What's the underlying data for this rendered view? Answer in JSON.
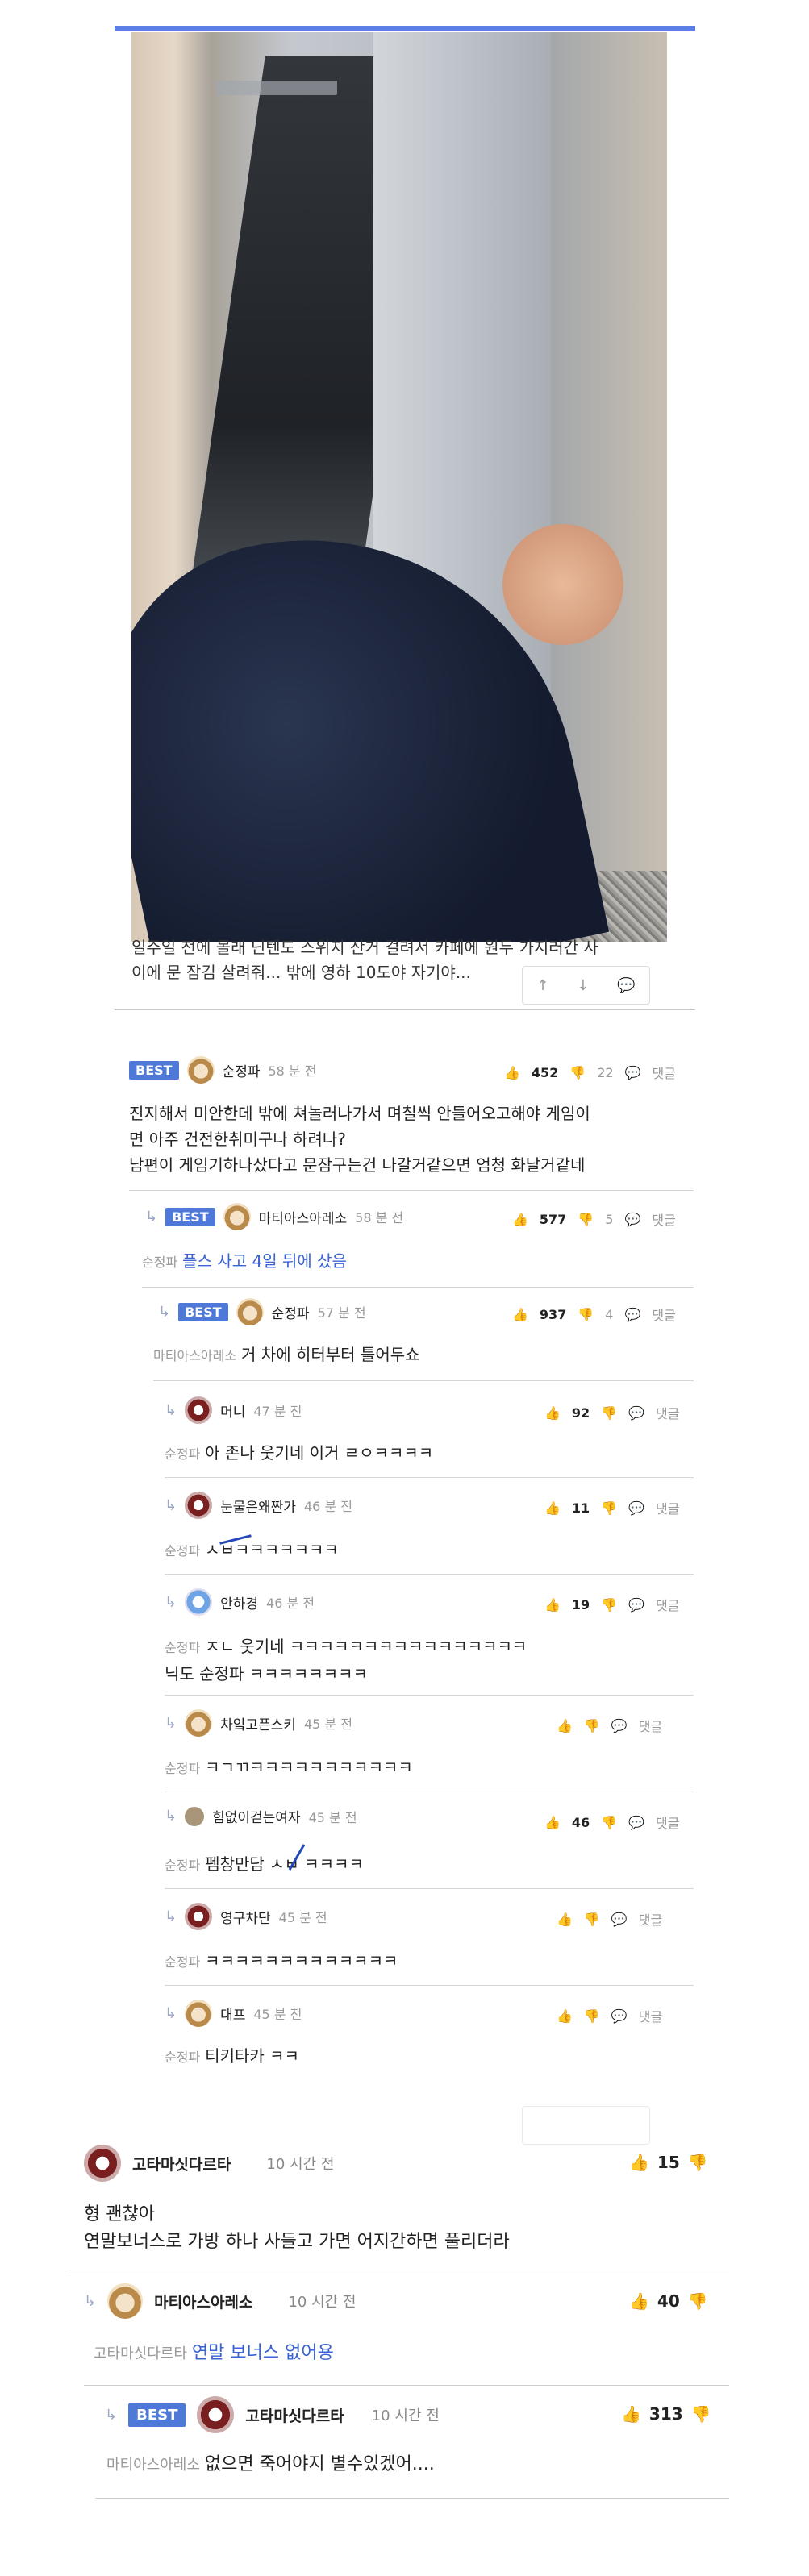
{
  "post": {
    "caption_line1": "일주일 전에 몰래 닌텐도 스위치 산거 걸려서  카페에 원두 가지러간 사",
    "caption_line2": "이에 문 잠김 살려줘... 밖에 영하 10도야 자기야...",
    "action_icons": [
      "↑",
      "↓",
      "💬"
    ]
  },
  "comments": [
    {
      "id": "c1",
      "best": "BEST",
      "name": "순정파",
      "time": "58 분 전",
      "up": "452",
      "down": "22",
      "reply": "댓글",
      "text": [
        "진지해서 미안한데 밖에 쳐놀러나가서 며칠씩 안들어오고해야 게임이",
        "면 아주 건전한취미구나 하려나?",
        "남편이 게임기하나샀다고 문잠구는건 나갈거같으면 엄청 화날거같네"
      ]
    },
    {
      "id": "c2",
      "best": "BEST",
      "name": "마티아스아레소",
      "time": "58 분 전",
      "up": "577",
      "down": "5",
      "reply": "댓글",
      "to": "순정파",
      "text": [
        "플스 사고 4일 뒤에 샀음"
      ]
    },
    {
      "id": "c3",
      "best": "BEST",
      "name": "순정파",
      "time": "57 분 전",
      "up": "937",
      "down": "4",
      "reply": "댓글",
      "to": "마티아스아레소",
      "text": [
        "거 차에 히터부터 틀어두쇼"
      ]
    },
    {
      "id": "c4",
      "name": "머니",
      "time": "47 분 전",
      "up": "92",
      "reply": "댓글",
      "to": "순정파",
      "text": [
        "아 존나 웃기네 이거 ㄹㅇㅋㅋㅋㅋ"
      ]
    },
    {
      "id": "c5",
      "name": "눈물은왜짠가",
      "time": "46 분 전",
      "up": "11",
      "reply": "댓글",
      "to": "순정파",
      "text": [
        "ㅅㅂㅋㅋㅋㅋㅋㅋㅋ"
      ]
    },
    {
      "id": "c6",
      "name": "안하경",
      "time": "46 분 전",
      "up": "19",
      "reply": "댓글",
      "to": "순정파",
      "text": [
        "ㅈㄴ 웃기네 ㅋㅋㅋㅋㅋㅋㅋㅋㅋㅋㅋㅋㅋㅋㅋㅋ",
        "닉도 순정파 ㅋㅋㅋㅋㅋㅋㅋㅋ"
      ]
    },
    {
      "id": "c7",
      "name": "차잌고픈스키",
      "time": "45 분 전",
      "reply": "댓글",
      "to": "순정파",
      "text": [
        "ㅋㄱㄲㅋㅋㅋㅋㅋㅋㅋㅋㅋㅋㅋ"
      ]
    },
    {
      "id": "c8",
      "name": "힘없이걷는여자",
      "time": "45 분 전",
      "up": "46",
      "reply": "댓글",
      "to": "순정파",
      "text": [
        "펨창만담 ㅅㅂ ㅋㅋㅋㅋ"
      ]
    },
    {
      "id": "c9",
      "name": "영구차단",
      "time": "45 분 전",
      "reply": "댓글",
      "to": "순정파",
      "text": [
        "ㅋㅋㅋㅋㅋㅋㅋㅋㅋㅋㅋㅋㅋ"
      ]
    },
    {
      "id": "c10",
      "name": "대프",
      "time": "45 분 전",
      "reply": "댓글",
      "to": "순정파",
      "text": [
        "티키타카 ㅋㅋ"
      ]
    }
  ],
  "second": [
    {
      "id": "s1",
      "name": "고타마싯다르타",
      "time": "10 시간 전",
      "up": "15",
      "text": [
        "형 괜찮아",
        "연말보너스로 가방 하나 사들고 가면 어지간하면 풀리더라"
      ]
    },
    {
      "id": "s2",
      "name": "마티아스아레소",
      "time": "10 시간 전",
      "up": "40",
      "to": "고타마싯다르타",
      "text": [
        "연말 보너스 없어용"
      ]
    },
    {
      "id": "s3",
      "best": "BEST",
      "name": "고타마싯다르타",
      "time": "10 시간 전",
      "up": "313",
      "to": "마티아스아레소",
      "text": [
        "없으면 죽어야지 별수있겠어...."
      ]
    }
  ],
  "icons": {
    "thumb_up": "👍",
    "thumb_down": "👎",
    "speech": "💬",
    "reply_arrow": "↳"
  }
}
